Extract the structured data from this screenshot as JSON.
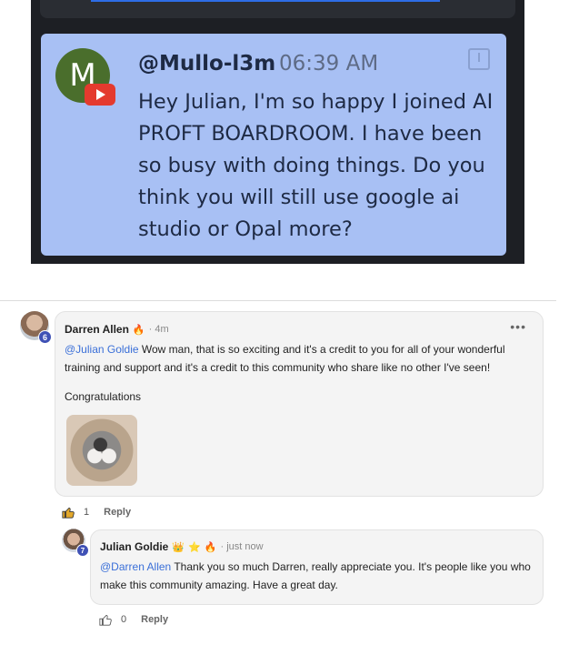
{
  "chat": {
    "avatar_letter": "M",
    "username": "@Mullo-l3m",
    "time": "06:39 AM",
    "message": "Hey Julian, I'm so happy I joined AI PROFT BOARDROOM. I have been so busy with doing things. Do you think you will still use google ai studio or Opal more?"
  },
  "comments": [
    {
      "author": "Darren Allen",
      "badges": [
        "🔥"
      ],
      "time": "· 4m",
      "level": "6",
      "menu": "•••",
      "mention": "@Julian Goldie",
      "text": " Wow man, that is so exciting and it's a credit to you for all of your wonderful training and support and it's a credit to this community who share like no other I've seen!",
      "text2": "Congratulations",
      "likes": "1",
      "reply_label": "Reply"
    },
    {
      "author": "Julian Goldie",
      "badges": [
        "👑",
        "⭐",
        "🔥"
      ],
      "time": "· just now",
      "level": "7",
      "mention": "@Darren Allen",
      "text": " Thank you so much Darren, really appreciate you. It's people like you who make this community amazing. Have a great day.",
      "likes": "0",
      "reply_label": "Reply"
    }
  ],
  "colors": {
    "chat_card": "#a8c0f4",
    "mention": "#3a6fd8",
    "level_badge": "#3f51b5"
  },
  "icons": [
    "youtube-icon",
    "pin-icon",
    "fire-icon",
    "crown-icon",
    "star-icon",
    "thumbs-up-icon",
    "more-icon"
  ]
}
